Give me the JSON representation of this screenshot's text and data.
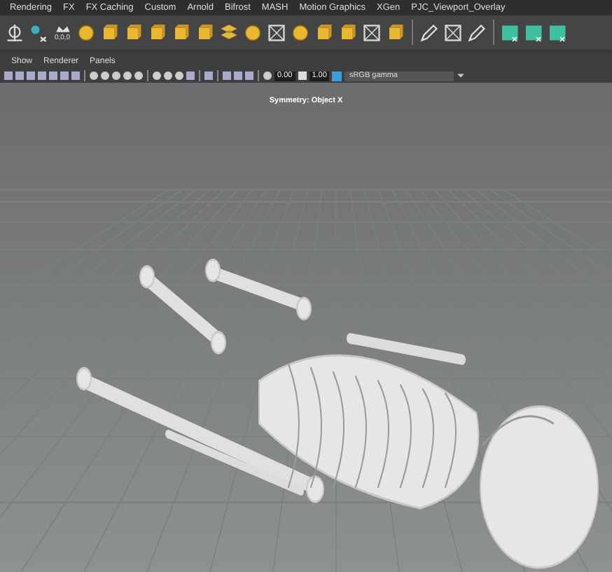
{
  "shelf_tabs": [
    "Rendering",
    "FX",
    "FX Caching",
    "Custom",
    "Arnold",
    "Bifrost",
    "MASH",
    "Motion Graphics",
    "XGen",
    "PJC_Viewport_Overlay"
  ],
  "shelf_icon_label": "0,0,0",
  "panel_menu": [
    "Show",
    "Renderer",
    "Panels"
  ],
  "toolbar": {
    "exposure": "0.00",
    "gamma": "1.00",
    "color_space": "sRGB gamma"
  },
  "viewport": {
    "hud_text": "Symmetry: Object X"
  }
}
